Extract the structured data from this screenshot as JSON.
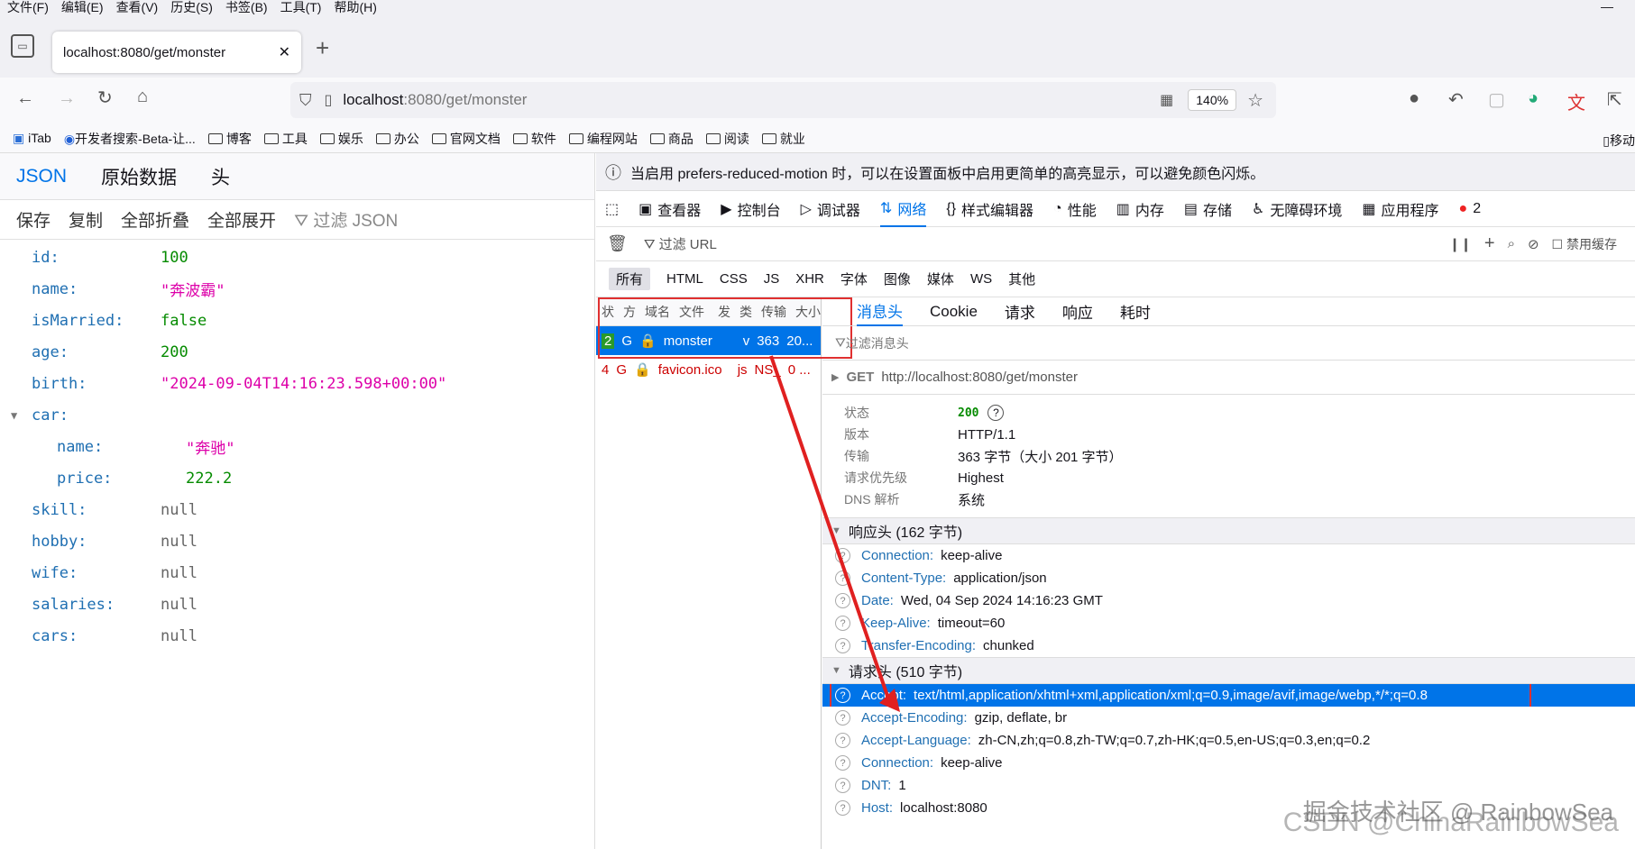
{
  "menu": [
    "文件(F)",
    "编辑(E)",
    "查看(V)",
    "历史(S)",
    "书签(B)",
    "工具(T)",
    "帮助(H)"
  ],
  "tab": {
    "title": "localhost:8080/get/monster"
  },
  "url": {
    "host": "localhost",
    "rest": ":8080/get/monster",
    "zoom": "140%"
  },
  "bookmarks": [
    "iTab",
    "开发者搜索-Beta-让...",
    "博客",
    "工具",
    "娱乐",
    "办公",
    "官网文档",
    "软件",
    "编程网站",
    "商品",
    "阅读",
    "就业"
  ],
  "bookmark_right": "移动",
  "json_viewer": {
    "tabs": [
      "JSON",
      "原始数据",
      "头"
    ],
    "toolbar": [
      "保存",
      "复制",
      "全部折叠",
      "全部展开"
    ],
    "filter_placeholder": "过滤 JSON",
    "rows": [
      {
        "key": "id:",
        "value": "100",
        "type": "num"
      },
      {
        "key": "name:",
        "value": "\"奔波霸\"",
        "type": "str"
      },
      {
        "key": "isMarried:",
        "value": "false",
        "type": "num"
      },
      {
        "key": "age:",
        "value": "200",
        "type": "num"
      },
      {
        "key": "birth:",
        "value": "\"2024-09-04T14:16:23.598+00:00\"",
        "type": "str"
      }
    ],
    "car": {
      "key": "car:",
      "name_key": "name:",
      "name_val": "\"奔驰\"",
      "price_key": "price:",
      "price_val": "222.2"
    },
    "rows2": [
      {
        "key": "skill:",
        "value": "null"
      },
      {
        "key": "hobby:",
        "value": "null"
      },
      {
        "key": "wife:",
        "value": "null"
      },
      {
        "key": "salaries:",
        "value": "null"
      },
      {
        "key": "cars:",
        "value": "null"
      }
    ]
  },
  "devtools": {
    "notice": "当启用 prefers-reduced-motion 时，可以在设置面板中启用更简单的高亮显示，可以避免颜色闪烁。",
    "tabs": [
      "查看器",
      "控制台",
      "调试器",
      "网络",
      "样式编辑器",
      "性能",
      "内存",
      "存储",
      "无障碍环境",
      "应用程序"
    ],
    "error_count": "2",
    "filter_url": "过滤 URL",
    "disable_cache": "禁用缓存",
    "types": [
      "所有",
      "HTML",
      "CSS",
      "JS",
      "XHR",
      "字体",
      "图像",
      "媒体",
      "WS",
      "其他"
    ],
    "list_header": [
      "状",
      "方",
      "域名",
      "文件",
      "发",
      "类",
      "传输",
      "大小"
    ],
    "requests": [
      {
        "status": "2",
        "method": "G",
        "file": "monster",
        "type": "v",
        "transfer": "363",
        "size": "20..."
      },
      {
        "status": "4",
        "method": "G",
        "file": "favicon.ico",
        "type": "js",
        "transfer": "NS_",
        "size": "0 ..."
      }
    ],
    "detail_tabs": [
      "消息头",
      "Cookie",
      "请求",
      "响应",
      "耗时"
    ],
    "filter_headers": "过滤消息头",
    "request_line": {
      "method": "GET",
      "url": "http://localhost:8080/get/monster"
    },
    "summary": [
      {
        "k": "状态",
        "v": "200"
      },
      {
        "k": "版本",
        "v": "HTTP/1.1"
      },
      {
        "k": "传输",
        "v": "363 字节（大小 201 字节）"
      },
      {
        "k": "请求优先级",
        "v": "Highest"
      },
      {
        "k": "DNS 解析",
        "v": "系统"
      }
    ],
    "response_headers_title": "响应头 (162 字节)",
    "response_headers": [
      {
        "n": "Connection:",
        "v": "keep-alive"
      },
      {
        "n": "Content-Type:",
        "v": "application/json"
      },
      {
        "n": "Date:",
        "v": "Wed, 04 Sep 2024 14:16:23 GMT"
      },
      {
        "n": "Keep-Alive:",
        "v": "timeout=60"
      },
      {
        "n": "Transfer-Encoding:",
        "v": "chunked"
      }
    ],
    "request_headers_title": "请求头 (510 字节)",
    "request_headers": [
      {
        "n": "Accept:",
        "v": "text/html,application/xhtml+xml,application/xml;q=0.9,image/avif,image/webp,*/*;q=0.8"
      },
      {
        "n": "Accept-Encoding:",
        "v": "gzip, deflate, br"
      },
      {
        "n": "Accept-Language:",
        "v": "zh-CN,zh;q=0.8,zh-TW;q=0.7,zh-HK;q=0.5,en-US;q=0.3,en;q=0.2"
      },
      {
        "n": "Connection:",
        "v": "keep-alive"
      },
      {
        "n": "DNT:",
        "v": "1"
      },
      {
        "n": "Host:",
        "v": "localhost:8080"
      }
    ]
  },
  "watermark": "CSDN @ChinaRainbowSea",
  "watermark2": "掘金技术社区 @ RainbowSea"
}
